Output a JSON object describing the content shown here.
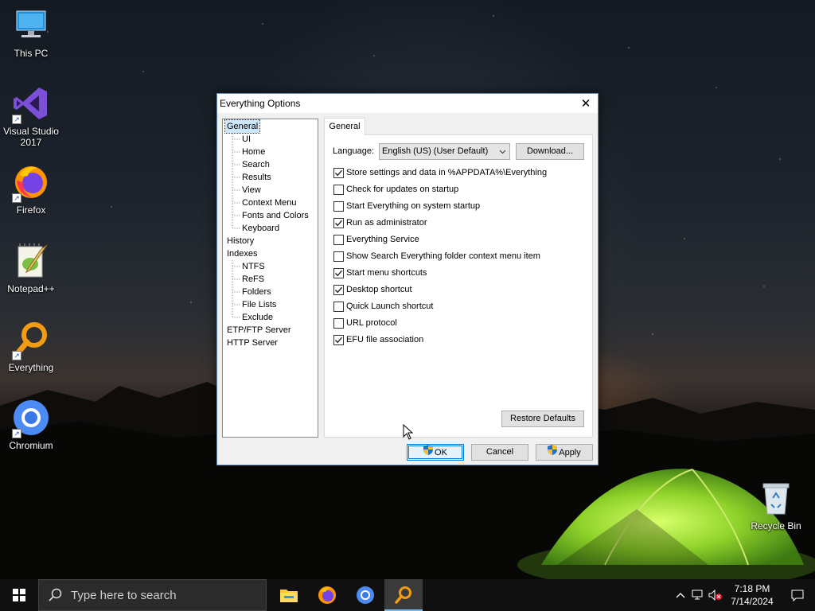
{
  "desktop": {
    "icons": [
      {
        "label": "This PC",
        "icon": "this-pc-icon"
      },
      {
        "label": "Visual Studio 2017",
        "icon": "visual-studio-icon"
      },
      {
        "label": "Firefox",
        "icon": "firefox-icon"
      },
      {
        "label": "Notepad++",
        "icon": "notepadpp-icon"
      },
      {
        "label": "Everything",
        "icon": "everything-icon"
      },
      {
        "label": "Chromium",
        "icon": "chromium-icon"
      },
      {
        "label": "Recycle Bin",
        "icon": "recycle-bin-icon"
      }
    ]
  },
  "dialog": {
    "title": "Everything Options",
    "close_glyph": "✕",
    "tree": [
      {
        "label": "General",
        "level": 0,
        "selected": true
      },
      {
        "label": "UI",
        "level": 1
      },
      {
        "label": "Home",
        "level": 1
      },
      {
        "label": "Search",
        "level": 1
      },
      {
        "label": "Results",
        "level": 1
      },
      {
        "label": "View",
        "level": 1
      },
      {
        "label": "Context Menu",
        "level": 1
      },
      {
        "label": "Fonts and Colors",
        "level": 1
      },
      {
        "label": "Keyboard",
        "level": 1
      },
      {
        "label": "History",
        "level": 0
      },
      {
        "label": "Indexes",
        "level": 0
      },
      {
        "label": "NTFS",
        "level": 1
      },
      {
        "label": "ReFS",
        "level": 1
      },
      {
        "label": "Folders",
        "level": 1
      },
      {
        "label": "File Lists",
        "level": 1
      },
      {
        "label": "Exclude",
        "level": 1
      },
      {
        "label": "ETP/FTP Server",
        "level": 0
      },
      {
        "label": "HTTP Server",
        "level": 0
      }
    ],
    "tab_label": "General",
    "language_label": "Language:",
    "language_value": "English (US) (User Default)",
    "download_label": "Download...",
    "options": [
      {
        "label": "Store settings and data in %APPDATA%\\Everything",
        "checked": true
      },
      {
        "label": "Check for updates on startup",
        "checked": false
      },
      {
        "label": "Start Everything on system startup",
        "checked": false
      },
      {
        "label": "Run as administrator",
        "checked": true
      },
      {
        "label": "Everything Service",
        "checked": false
      },
      {
        "label": "Show Search Everything folder context menu item",
        "checked": false
      },
      {
        "label": "Start menu shortcuts",
        "checked": true
      },
      {
        "label": "Desktop shortcut",
        "checked": true
      },
      {
        "label": "Quick Launch shortcut",
        "checked": false
      },
      {
        "label": "URL protocol",
        "checked": false
      },
      {
        "label": "EFU file association",
        "checked": true
      }
    ],
    "restore_defaults_label": "Restore Defaults",
    "ok_label": "OK",
    "cancel_label": "Cancel",
    "apply_label": "Apply"
  },
  "taskbar": {
    "search_placeholder": "Type here to search",
    "apps": [
      {
        "name": "file-explorer",
        "icon": "folder-icon",
        "active": false
      },
      {
        "name": "firefox",
        "icon": "firefox-icon",
        "active": false
      },
      {
        "name": "chromium",
        "icon": "chromium-icon",
        "active": false
      },
      {
        "name": "everything",
        "icon": "everything-icon",
        "active": true
      }
    ],
    "time": "7:18 PM",
    "date": "7/14/2024"
  },
  "colors": {
    "accent": "#0078d7",
    "everything_orange": "#f39c12",
    "tent_green": "#7ed321"
  }
}
